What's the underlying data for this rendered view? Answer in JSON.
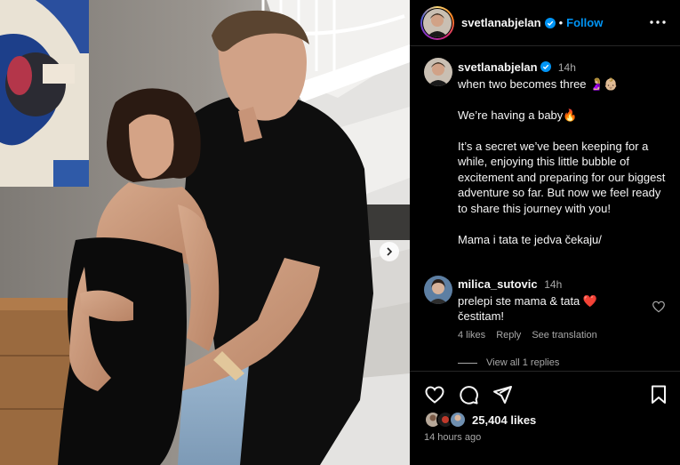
{
  "post": {
    "username": "svetlanabjelan",
    "follow_label": "Follow",
    "separator": "•",
    "verified_icon": "verified-badge-icon",
    "accent": "#0095f6"
  },
  "caption": {
    "username": "svetlanabjelan",
    "time": "14h",
    "lines": [
      "when two becomes three 🤰🏼👶🏼",
      "",
      "We’re having a baby🔥",
      "",
      "It’s a secret we’ve been keeping for a while, enjoying this little bubble of excitement and preparing for our biggest adventure so far. But now we feel ready to share this journey with you!",
      "",
      "Mama i tata te jedva čekaju/"
    ]
  },
  "comment": {
    "username": "milica_sutovic",
    "time": "14h",
    "line1": "prelepi ste mama & tata ❤️",
    "line2": "čestitam!",
    "likes": "4 likes",
    "reply": "Reply",
    "translate": "See translation",
    "view_replies": "View all 1 replies"
  },
  "footer": {
    "likes": "25,404 likes",
    "posted": "14 hours ago"
  }
}
